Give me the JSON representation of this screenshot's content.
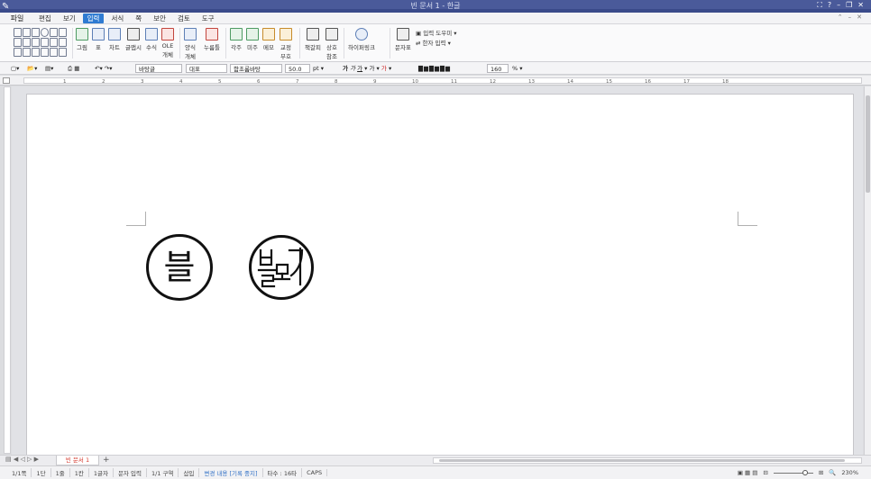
{
  "titlebar": {
    "title": "빈 문서 1 - 한글",
    "help": "?"
  },
  "menubar": {
    "file": "파일",
    "items": [
      {
        "label": "편집",
        "active": false
      },
      {
        "label": "보기",
        "active": false
      },
      {
        "label": "입력",
        "active": true
      },
      {
        "label": "서식",
        "active": false
      },
      {
        "label": "쪽",
        "active": false
      },
      {
        "label": "보안",
        "active": false
      },
      {
        "label": "검토",
        "active": false
      },
      {
        "label": "도구",
        "active": false
      }
    ]
  },
  "ribbon": {
    "picture": "그림",
    "table": "표",
    "chart": "차트",
    "textart": "글맵시",
    "equation": "수식",
    "ole1": "OLE",
    "ole2": "개체",
    "form1": "양식",
    "form2": "개체",
    "press": "누름틀",
    "footnote": "각주",
    "endnote": "미주",
    "memo": "메모",
    "fixed1": "교정",
    "fixed2": "부호",
    "bookmark": "책갈피",
    "cross1": "상호",
    "cross2": "참조",
    "hyperlink": "하이퍼링크",
    "charmap": "문자표",
    "input_tool": "입력 도우미",
    "hanja_input": "한자 입력"
  },
  "fmtbar": {
    "style": "바탕글",
    "lang": "대표",
    "font": "함초롬바탕",
    "size": "50.0",
    "unit": "pt",
    "line_spacing": "160",
    "percent": "%"
  },
  "ruler": {
    "numbers": [
      "1",
      "2",
      "3",
      "4",
      "5",
      "6",
      "7",
      "8",
      "9",
      "10",
      "11",
      "12",
      "13",
      "14",
      "15",
      "16",
      "17",
      "18"
    ]
  },
  "seals": {
    "text_seal": "블"
  },
  "tabs": {
    "doc_tab": "빈 문서 1",
    "add": "+"
  },
  "status": {
    "items": [
      "1/1쪽",
      "1단",
      "1줄",
      "1칸",
      "1글자",
      "문자 입력",
      "1/1 구역",
      "삽입",
      "변경 내용 [기록 중지]",
      "타수 : 16타",
      "CAPS"
    ],
    "zoom": "230%"
  }
}
